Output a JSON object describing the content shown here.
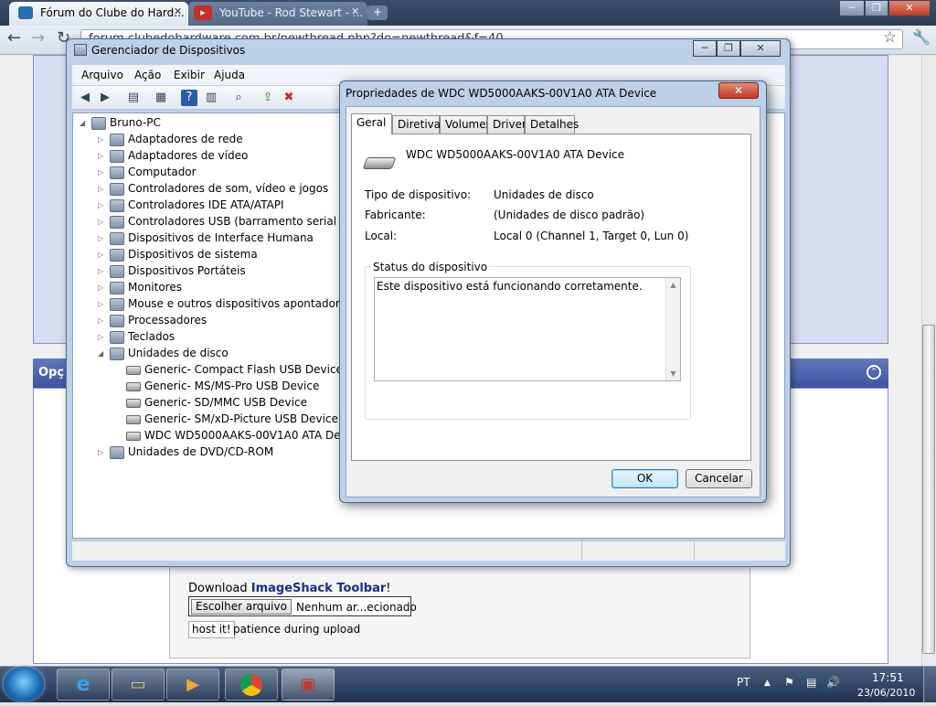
{
  "browser": {
    "tabs": [
      {
        "label": "Fórum do Clube do Hard...",
        "active": true
      },
      {
        "label": "YouTube - Rod Stewart - ...",
        "active": false
      }
    ],
    "url": "forum.clubedohardware.com.br/newthread.php?do=newthread&f=40",
    "win_controls": [
      "─",
      "❐",
      "✕"
    ]
  },
  "webpage": {
    "options_bar_label": "Opç",
    "download_prefix": "Download ",
    "download_link": "ImageShack Toolbar",
    "download_suffix": "!",
    "choose_file_button": "Escolher arquivo",
    "no_file_text": "Nenhum ar...ecionado",
    "host_button": "host it!",
    "host_note": "patience during upload"
  },
  "device_manager": {
    "title": "Gerenciador de Dispositivos",
    "menu": [
      "Arquivo",
      "Ação",
      "Exibir",
      "Ajuda"
    ],
    "tree_root": "Bruno-PC",
    "categories": [
      "Adaptadores de rede",
      "Adaptadores de vídeo",
      "Computador",
      "Controladores de som, vídeo e jogos",
      "Controladores IDE ATA/ATAPI",
      "Controladores USB (barramento serial universal)",
      "Dispositivos de Interface Humana",
      "Dispositivos de sistema",
      "Dispositivos Portáteis",
      "Monitores",
      "Mouse e outros dispositivos apontadores",
      "Processadores",
      "Teclados",
      "Unidades de disco"
    ],
    "disk_devices": [
      "Generic- Compact Flash USB Device",
      "Generic- MS/MS-Pro USB Device",
      "Generic- SD/MMC USB Device",
      "Generic- SM/xD-Picture USB Device",
      "WDC WD5000AAKS-00V1A0 ATA Device"
    ],
    "last_category": "Unidades de DVD/CD-ROM"
  },
  "properties": {
    "title": "Propriedades de WDC WD5000AAKS-00V1A0 ATA Device",
    "close_glyph": "✕",
    "tabs": [
      "Geral",
      "Diretivas",
      "Volumes",
      "Driver",
      "Detalhes"
    ],
    "device_name": "WDC WD5000AAKS-00V1A0 ATA Device",
    "fields": [
      {
        "label": "Tipo de dispositivo:",
        "value": "Unidades de disco"
      },
      {
        "label": "Fabricante:",
        "value": "(Unidades de disco padrão)"
      },
      {
        "label": "Local:",
        "value": "Local 0 (Channel 1, Target 0, Lun 0)"
      }
    ],
    "status_group_label": "Status do dispositivo",
    "status_text": "Este dispositivo está funcionando corretamente.",
    "ok_label": "OK",
    "cancel_label": "Cancelar"
  },
  "taskbar": {
    "language": "PT",
    "time": "17:51",
    "date": "23/06/2010"
  }
}
